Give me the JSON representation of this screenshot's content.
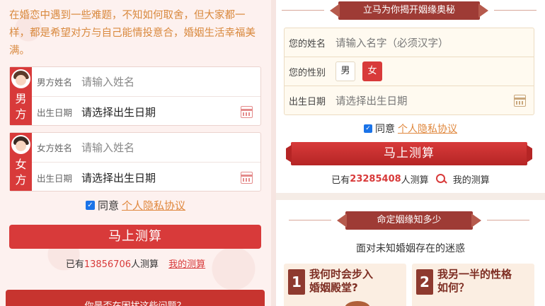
{
  "left": {
    "intro": "在婚恋中遇到一些难题，不知如何取舍，但大家都一样，都是希望对方与自己能情投意合，婚姻生活幸福美满。",
    "male": {
      "side_text": "男方",
      "name_label": "男方姓名",
      "name_placeholder": "请输入姓名",
      "date_label": "出生日期",
      "date_value": "请选择出生日期"
    },
    "female": {
      "side_text": "女方",
      "name_label": "女方姓名",
      "name_placeholder": "请输入姓名",
      "date_label": "出生日期",
      "date_value": "请选择出生日期"
    },
    "agree_text": "同意",
    "agree_link": "个人隐私协议",
    "submit": "马上测算",
    "count_prefix": "已有",
    "count_number": "13856706",
    "count_suffix": "人测算",
    "my_test": "我的测算",
    "banner": "你是否在困扰这些问题？"
  },
  "right": {
    "ribbon_top": "立马为你揭开姻缘奥秘",
    "name_label": "您的姓名",
    "name_placeholder": "请输入名字（必须汉字）",
    "gender_label": "您的性别",
    "gender_male": "男",
    "gender_female": "女",
    "date_label": "出生日期",
    "date_placeholder": "请选择出生日期",
    "agree_text": "同意",
    "agree_link": "个人隐私协议",
    "submit": "马上测算",
    "count_prefix": "已有",
    "count_number": "23285408",
    "count_suffix": "人测算",
    "my_test": "我的测算",
    "ribbon_mid": "命定姻缘知多少",
    "sub_text": "面对未知婚姻存在的迷惑",
    "cards": [
      {
        "num": "1",
        "line1": "我何时会步入",
        "line2": "婚姻殿堂?"
      },
      {
        "num": "2",
        "line1": "我另一半的性格",
        "line2": "如何？"
      }
    ]
  }
}
